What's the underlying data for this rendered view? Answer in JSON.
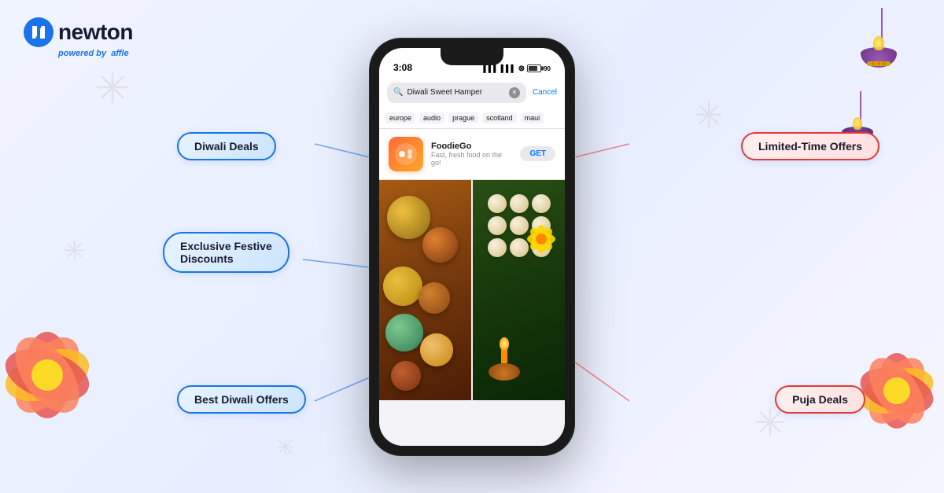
{
  "brand": {
    "logo_text": "newton",
    "powered_label": "powered by",
    "affle_label": "affle"
  },
  "phone": {
    "status_bar": {
      "time": "3:08",
      "battery_label": "90"
    },
    "search": {
      "placeholder": "Diwali Sweet Hamper",
      "cancel_label": "Cancel"
    },
    "tags": [
      "europe",
      "audio",
      "prague",
      "scotland",
      "maui"
    ],
    "app": {
      "name": "FoodieGo",
      "description": "Fast, fresh food on the go!",
      "get_label": "GET"
    }
  },
  "pills": {
    "diwali_deals": "Diwali Deals",
    "limited_time": "Limited-Time Offers",
    "exclusive": "Exclusive Festive Discounts",
    "best_diwali": "Best Diwali Offers",
    "puja_deals": "Puja Deals"
  },
  "colors": {
    "accent_blue": "#1a73e8",
    "accent_red": "#e53935",
    "phone_dark": "#1a1a1a"
  }
}
